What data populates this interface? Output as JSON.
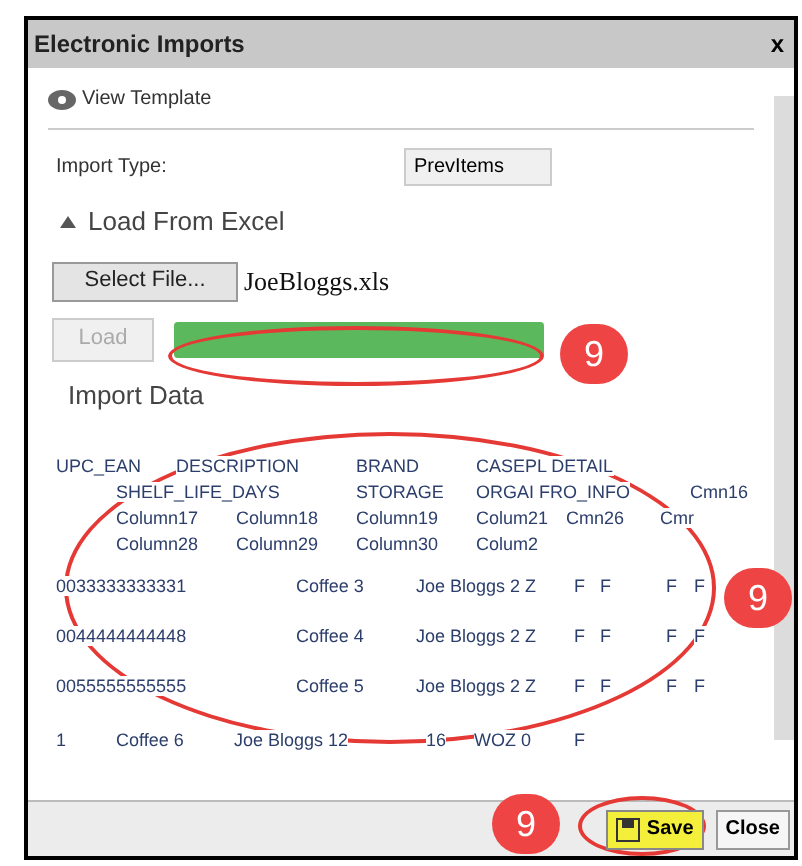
{
  "window": {
    "title": "Electronic Imports",
    "close": "x"
  },
  "view_template": {
    "label": "View Template"
  },
  "import_type": {
    "label": "Import Type:",
    "value": "PrevItems"
  },
  "section": {
    "label": "Load From Excel",
    "expanded": true
  },
  "file": {
    "button": "Select File...",
    "name": "JoeBloggs.xls"
  },
  "load": {
    "label": "Load",
    "disabled": true
  },
  "progress": {
    "level": 1
  },
  "import_data": {
    "title": "Import Data",
    "header": {
      "cells": [
        "UPC_EAN",
        "DESCRIPTION",
        "BRAND",
        "CASEPL DETAIL"
      ]
    },
    "wrapped_header_lines": [
      {
        "cells": [
          "SHELF_LIFE_DAYS",
          "STORAGE",
          "ORGAI FRO_INFO",
          "Cmn16"
        ]
      },
      {
        "cells": [
          "Column17",
          "Column18",
          "Column19",
          "Colum21",
          "Cmn26",
          "Cmr"
        ]
      },
      {
        "cells": [
          "Column28",
          "Column29",
          "Column30",
          "Colum2"
        ]
      }
    ],
    "rows": [
      {
        "cells": [
          "0033333333331",
          "Coffee 3",
          "Joe Bloggs 2 Z",
          "F",
          "F",
          "F",
          "F"
        ]
      },
      {
        "cells": [
          "0044444444448",
          "Coffee 4",
          "Joe Bloggs 2 Z",
          "F",
          "F",
          "F",
          "F"
        ]
      },
      {
        "cells": [
          "0055555555555",
          "Coffee 5",
          "Joe Bloggs 2 Z",
          "F",
          "F",
          "F",
          "F"
        ]
      }
    ],
    "trailing_row": {
      "cells": [
        "1",
        "Coffee 6",
        "Joe Bloggs 12",
        "16",
        "WOZ 0",
        "F"
      ]
    }
  },
  "footer": {
    "buttons": [
      {
        "label": "Save",
        "kind": "save",
        "highlighted": true
      },
      {
        "label": "Close",
        "kind": "close",
        "highlighted": false
      }
    ]
  },
  "callouts": [
    {
      "label": "9"
    },
    {
      "label": "9"
    },
    {
      "label": "9"
    }
  ]
}
